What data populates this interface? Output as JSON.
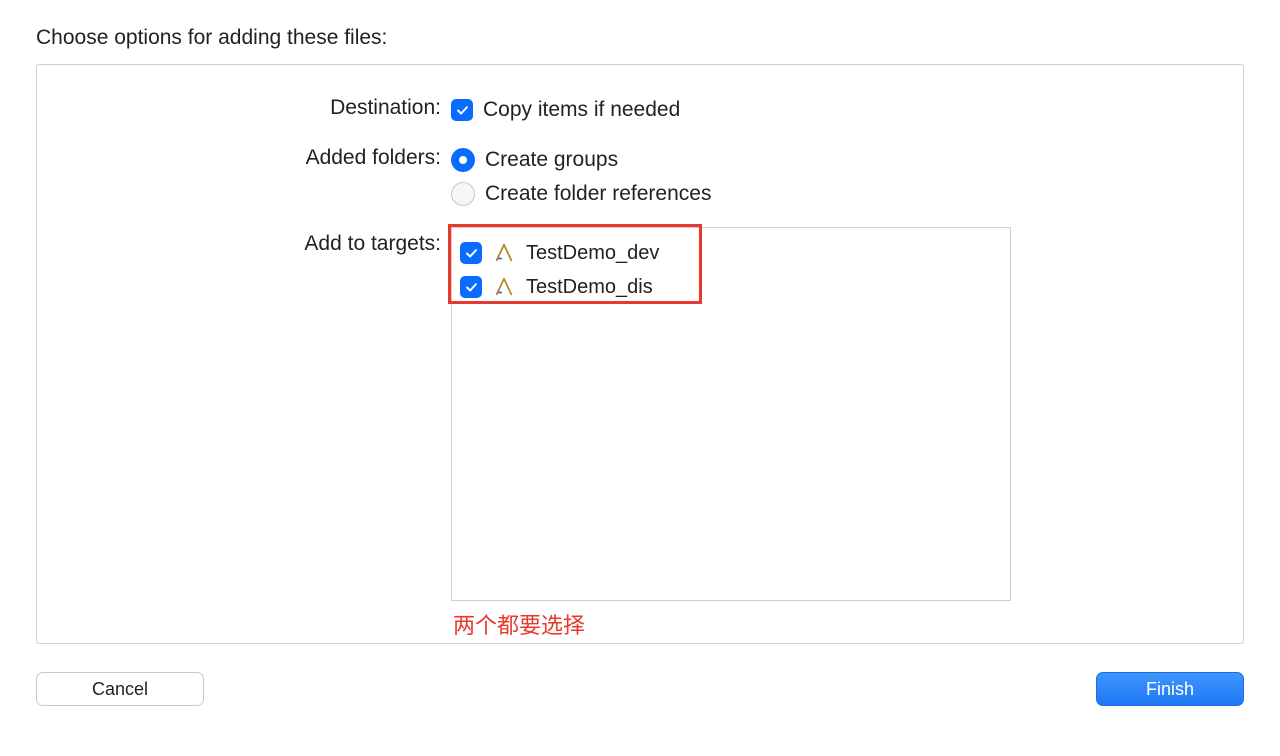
{
  "title": "Choose options for adding these files:",
  "destination": {
    "label": "Destination:",
    "copy_items": {
      "label": "Copy items if needed",
      "checked": true
    }
  },
  "added_folders": {
    "label": "Added folders:",
    "options": [
      {
        "label": "Create groups",
        "selected": true
      },
      {
        "label": "Create folder references",
        "selected": false
      }
    ]
  },
  "targets": {
    "label": "Add to targets:",
    "items": [
      {
        "name": "TestDemo_dev",
        "checked": true
      },
      {
        "name": "TestDemo_dis",
        "checked": true
      }
    ]
  },
  "annotation": "两个都要选择",
  "buttons": {
    "cancel": "Cancel",
    "finish": "Finish"
  }
}
